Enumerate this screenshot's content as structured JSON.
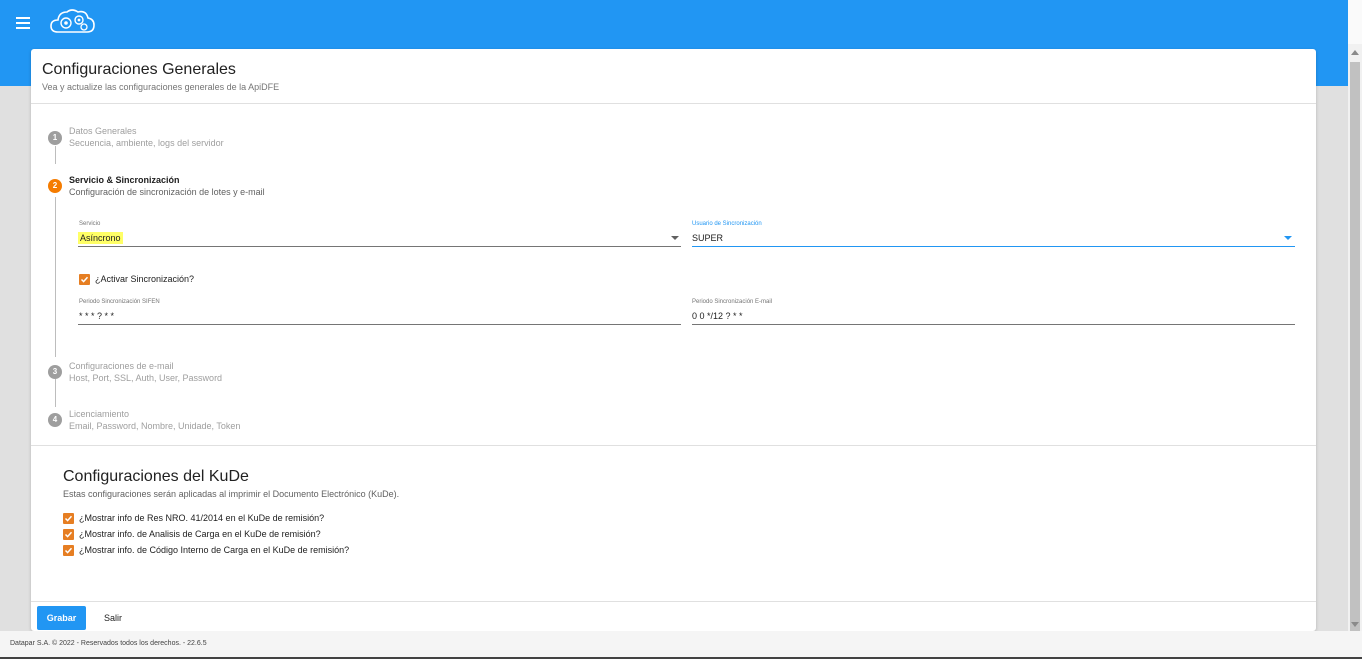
{
  "header": {
    "menu_icon": "hamburger-menu-icon",
    "logo_icon": "cloud-gears-logo-icon",
    "brand_color": "#2196f3"
  },
  "card": {
    "title": "Configuraciones Generales",
    "subtitle": "Vea y actualize las configuraciones generales de la ApiDFE"
  },
  "steps": [
    {
      "number": "1",
      "title": "Datos Generales",
      "subtitle": "Secuencia, ambiente, logs del servidor"
    },
    {
      "number": "2",
      "title": "Servicio & Sincronización",
      "subtitle": "Configuración de sincronización de lotes y e-mail"
    },
    {
      "number": "3",
      "title": "Configuraciones de e-mail",
      "subtitle": "Host, Port, SSL, Auth, User, Password"
    },
    {
      "number": "4",
      "title": "Licenciamiento",
      "subtitle": "Email, Password, Nombre, Unidade, Token"
    }
  ],
  "sync_form": {
    "servicio_label": "Servicio",
    "servicio_value": "Asíncrono",
    "usuario_label": "Usuario de Sincronización",
    "usuario_value": "SUPER",
    "activar_label": "¿Activar Sincronización?",
    "activar_checked": true,
    "periodo_sifen_label": "Periodo Sincronización SIFEN",
    "periodo_sifen_value": "* * * ? * *",
    "periodo_email_label": "Periodo Sincronización E-mail",
    "periodo_email_value": "0 0 */12 ? * *"
  },
  "kude": {
    "title": "Configuraciones del KuDe",
    "subtitle": "Estas configuraciones serán aplicadas al imprimir el Documento Electrónico (KuDe).",
    "options": [
      {
        "label": "¿Mostrar info de Res NRO. 41/2014 en el KuDe de remisión?",
        "checked": true
      },
      {
        "label": "¿Mostrar info. de Analisis de Carga en el KuDe de remisión?",
        "checked": true
      },
      {
        "label": "¿Mostrar info. de Código Interno de Carga en el KuDe de remisión?",
        "checked": true
      }
    ]
  },
  "actions": {
    "save_label": "Grabar",
    "exit_label": "Salir"
  },
  "footer": {
    "text": "Datapar S.A. © 2022 - Reservados todos los derechos. - 22.6.5"
  },
  "colors": {
    "active_step": "#f57c00",
    "checkbox": "#e67e22",
    "highlight": "#ffff66"
  }
}
